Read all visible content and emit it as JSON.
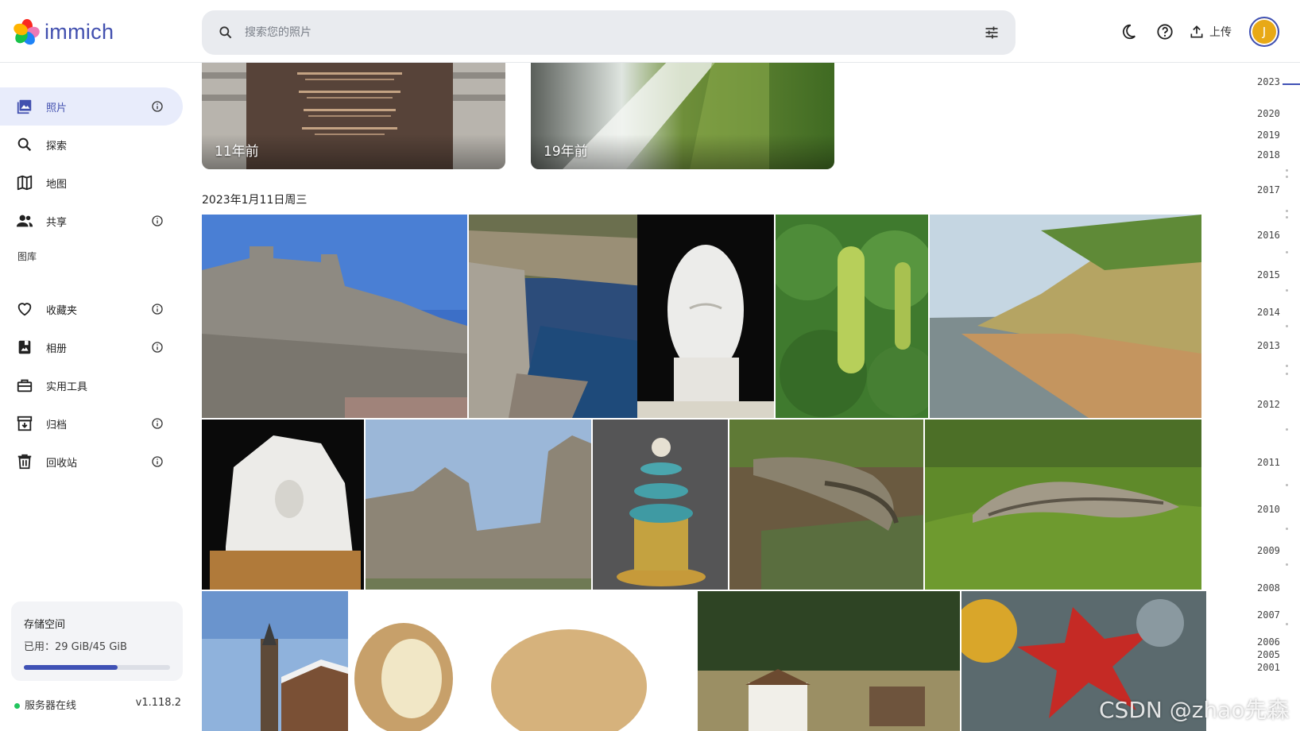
{
  "app": {
    "name": "immich"
  },
  "search": {
    "placeholder": "搜索您的照片"
  },
  "header": {
    "upload_label": "上传",
    "avatar_initial": "J"
  },
  "sidebar": {
    "items": [
      {
        "label": "照片",
        "icon": "photos-icon",
        "active": true,
        "info": true
      },
      {
        "label": "探索",
        "icon": "search-icon",
        "info": false
      },
      {
        "label": "地图",
        "icon": "map-icon",
        "info": false
      },
      {
        "label": "共享",
        "icon": "people-icon",
        "info": true
      }
    ],
    "library_label": "图库",
    "library_items": [
      {
        "label": "收藏夹",
        "icon": "heart-icon",
        "info": true
      },
      {
        "label": "相册",
        "icon": "album-icon",
        "info": true
      },
      {
        "label": "实用工具",
        "icon": "toolbox-icon",
        "info": false
      },
      {
        "label": "归档",
        "icon": "archive-icon",
        "info": true
      },
      {
        "label": "回收站",
        "icon": "trash-icon",
        "info": true
      }
    ],
    "storage": {
      "title": "存储空间",
      "used_text": "已用：29 GiB/45 GiB",
      "used_fraction": 0.644
    },
    "server": {
      "status": "服务器在线",
      "version": "v1.118.2"
    }
  },
  "memories": [
    {
      "label": "11年前"
    },
    {
      "label": "19年前"
    }
  ],
  "date_group": {
    "heading": "2023年1月11日周三"
  },
  "timeline": {
    "years": [
      "2023",
      "2020",
      "2019",
      "2018",
      "2017",
      "2016",
      "2015",
      "2014",
      "2013",
      "2012",
      "2011",
      "2010",
      "2009",
      "2008",
      "2007",
      "2006",
      "2005",
      "2001"
    ]
  },
  "watermark": "CSDN @zhao先森",
  "colors": {
    "accent": "#4250af",
    "online": "#22c55e"
  }
}
